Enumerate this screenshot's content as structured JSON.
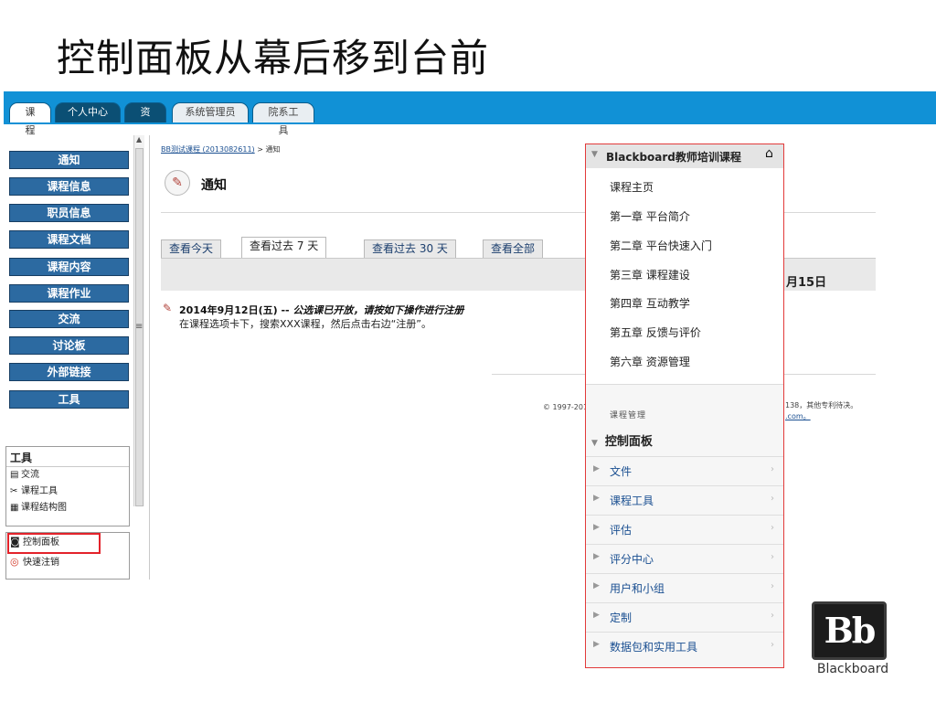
{
  "slide_title": "控制面板从幕后移到台前",
  "top_tabs": [
    {
      "label": "课程"
    },
    {
      "label": "个人中心"
    },
    {
      "label": "资源"
    },
    {
      "label": "系统管理员"
    },
    {
      "label": "院系工具"
    }
  ],
  "sidebar": {
    "buttons": [
      {
        "label": "通知"
      },
      {
        "label": "课程信息"
      },
      {
        "label": "职员信息"
      },
      {
        "label": "课程文档"
      },
      {
        "label": "课程内容"
      },
      {
        "label": "课程作业"
      },
      {
        "label": "交流"
      },
      {
        "label": "讨论板"
      },
      {
        "label": "外部链接"
      },
      {
        "label": "工具"
      }
    ],
    "tools_box": {
      "title": "工具",
      "items": [
        {
          "label": "交流",
          "icon": "chat-icon"
        },
        {
          "label": "课程工具",
          "icon": "wrench-icon"
        },
        {
          "label": "课程结构图",
          "icon": "map-icon"
        }
      ]
    },
    "control_items": [
      {
        "label": "控制面板",
        "icon": "control-panel-icon"
      },
      {
        "label": "快速注销",
        "icon": "logout-icon"
      }
    ]
  },
  "content": {
    "breadcrumb_link": "BB测试课程 (2013082611)",
    "breadcrumb_tail": "> 通知",
    "page_title": "通知",
    "tabs": [
      {
        "label": "查看今天"
      },
      {
        "label": "查看过去 7 天"
      },
      {
        "label": "查看过去 30 天"
      },
      {
        "label": "查看全部"
      }
    ],
    "date_fragment": "月15日",
    "notice": {
      "date": "2014年9月12日(五) -- ",
      "title": "公选课已开放，请按如下操作进行注册",
      "body": "在课程选项卡下，搜索XXX课程，然后点击右边“注册”。"
    },
    "copyright_left": "© 1997-201",
    "copyright_right": "138，其他专利待决。",
    "copyright_link": ".com。"
  },
  "course_menu": {
    "title": "Blackboard教师培训课程",
    "links": [
      {
        "label": "课程主页"
      },
      {
        "label": "第一章 平台简介"
      },
      {
        "label": "第二章 平台快速入门"
      },
      {
        "label": "第三章 课程建设"
      },
      {
        "label": "第四章 互动教学"
      },
      {
        "label": "第五章 反馈与评价"
      },
      {
        "label": "第六章 资源管理"
      }
    ],
    "management_label": "课程管理",
    "control_panel_label": "控制面板",
    "cp_items": [
      {
        "label": "文件"
      },
      {
        "label": "课程工具"
      },
      {
        "label": "评估"
      },
      {
        "label": "评分中心"
      },
      {
        "label": "用户和小组"
      },
      {
        "label": "定制"
      },
      {
        "label": "数据包和实用工具"
      }
    ]
  },
  "logo": {
    "mark": "Bb",
    "word": "Blackboard"
  }
}
